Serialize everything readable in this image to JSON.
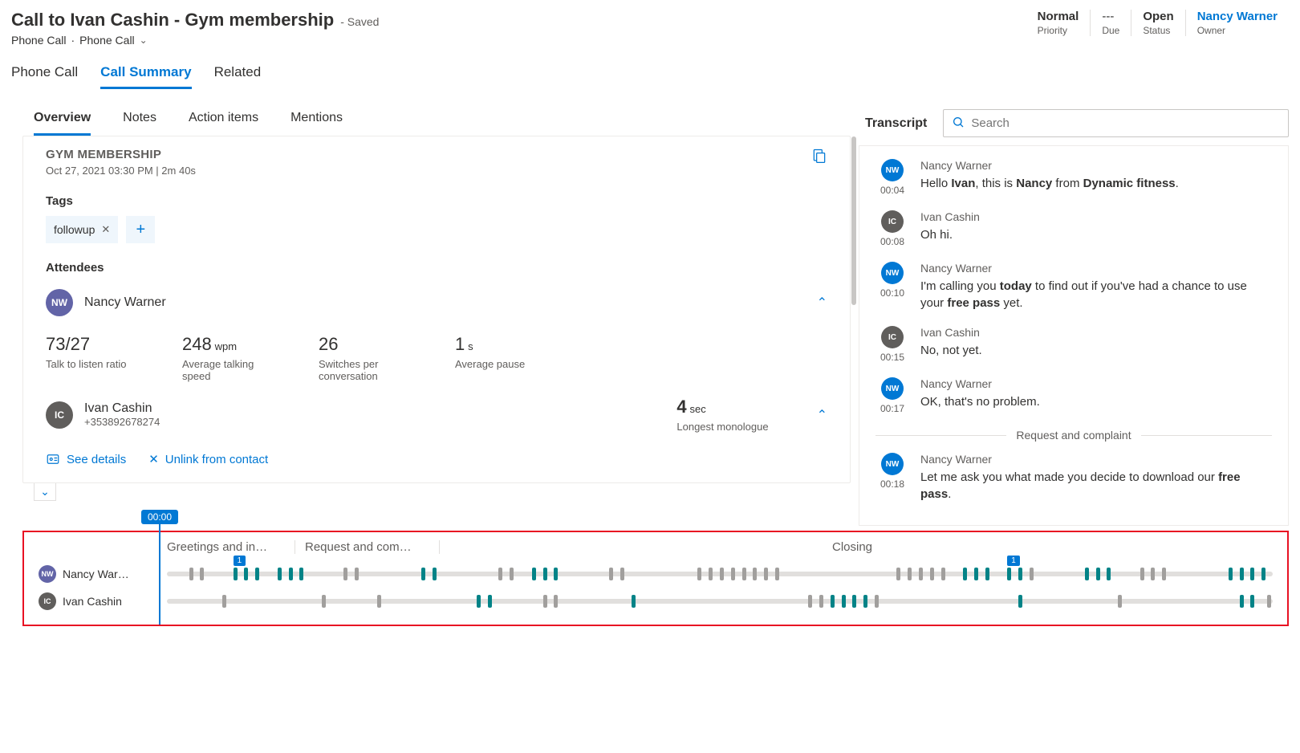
{
  "header": {
    "title": "Call to Ivan Cashin - Gym membership",
    "saved": "- Saved",
    "entity": "Phone Call",
    "subtype": "Phone Call",
    "meta": [
      {
        "value": "Normal",
        "label": "Priority",
        "bold": true
      },
      {
        "value": "---",
        "label": "Due"
      },
      {
        "value": "Open",
        "label": "Status",
        "bold": true
      },
      {
        "value": "Nancy Warner",
        "label": "Owner",
        "link": true
      }
    ]
  },
  "mainTabs": [
    "Phone Call",
    "Call Summary",
    "Related"
  ],
  "mainTabActive": 1,
  "subTabs": [
    "Overview",
    "Notes",
    "Action items",
    "Mentions"
  ],
  "subTabActive": 0,
  "overview": {
    "heading": "GYM MEMBERSHIP",
    "metaLine": "Oct 27, 2021 03:30 PM  |  2m 40s",
    "tagsLabel": "Tags",
    "tags": [
      "followup"
    ],
    "attendeesLabel": "Attendees",
    "attendee1": {
      "initials": "NW",
      "name": "Nancy Warner"
    },
    "stats": [
      {
        "value": "73/27",
        "label": "Talk to listen ratio"
      },
      {
        "value": "248",
        "unit": "wpm",
        "label": "Average talking speed"
      },
      {
        "value": "26",
        "label": "Switches per conversation"
      },
      {
        "value": "1",
        "unit": "s",
        "label": "Average pause"
      }
    ],
    "attendee2": {
      "initials": "IC",
      "name": "Ivan Cashin",
      "phone": "+353892678274"
    },
    "monologue": {
      "value": "4",
      "unit": "sec",
      "label": "Longest monologue"
    },
    "actions": {
      "details": "See details",
      "unlink": "Unlink from contact"
    }
  },
  "transcript": {
    "headLabel": "Transcript",
    "searchPlaceholder": "Search",
    "sectionLabel": "Request and complaint",
    "messages": [
      {
        "av": "nw",
        "initials": "NW",
        "time": "00:04",
        "speaker": "Nancy Warner",
        "html": "Hello <b>Ivan</b>, this is <b>Nancy</b> from <b>Dynamic fitness</b>."
      },
      {
        "av": "ic",
        "initials": "IC",
        "time": "00:08",
        "speaker": "Ivan Cashin",
        "html": "Oh hi."
      },
      {
        "av": "nw",
        "initials": "NW",
        "time": "00:10",
        "speaker": "Nancy Warner",
        "html": "I'm calling you <b>today</b> to find out if you've had a chance to use your <b>free pass</b> yet."
      },
      {
        "av": "ic",
        "initials": "IC",
        "time": "00:15",
        "speaker": "Ivan Cashin",
        "html": "No, not yet."
      },
      {
        "av": "nw",
        "initials": "NW",
        "time": "00:17",
        "speaker": "Nancy Warner",
        "html": "OK, that's no problem."
      },
      {
        "_divider": true
      },
      {
        "av": "nw",
        "initials": "NW",
        "time": "00:18",
        "speaker": "Nancy Warner",
        "html": "Let me ask you what made you decide to download our <b>free pass</b>."
      }
    ]
  },
  "timeline": {
    "playhead": "00:00",
    "segments": {
      "greet": "Greetings and in…",
      "req": "Request and com…",
      "close": "Closing"
    },
    "rows": [
      {
        "av": "nw",
        "initials": "NW",
        "name": "Nancy War…",
        "markers": [
          6,
          76
        ],
        "ticks": [
          {
            "p": 2,
            "c": "gr"
          },
          {
            "p": 3,
            "c": "gr"
          },
          {
            "p": 6,
            "c": "te"
          },
          {
            "p": 7,
            "c": "te"
          },
          {
            "p": 8,
            "c": "te"
          },
          {
            "p": 10,
            "c": "te"
          },
          {
            "p": 11,
            "c": "te"
          },
          {
            "p": 12,
            "c": "te"
          },
          {
            "p": 16,
            "c": "gr"
          },
          {
            "p": 17,
            "c": "gr"
          },
          {
            "p": 23,
            "c": "te"
          },
          {
            "p": 24,
            "c": "te"
          },
          {
            "p": 30,
            "c": "gr"
          },
          {
            "p": 31,
            "c": "gr"
          },
          {
            "p": 33,
            "c": "te"
          },
          {
            "p": 34,
            "c": "te"
          },
          {
            "p": 35,
            "c": "te"
          },
          {
            "p": 40,
            "c": "gr"
          },
          {
            "p": 41,
            "c": "gr"
          },
          {
            "p": 48,
            "c": "gr"
          },
          {
            "p": 49,
            "c": "gr"
          },
          {
            "p": 50,
            "c": "gr"
          },
          {
            "p": 51,
            "c": "gr"
          },
          {
            "p": 52,
            "c": "gr"
          },
          {
            "p": 53,
            "c": "gr"
          },
          {
            "p": 54,
            "c": "gr"
          },
          {
            "p": 55,
            "c": "gr"
          },
          {
            "p": 66,
            "c": "gr"
          },
          {
            "p": 67,
            "c": "gr"
          },
          {
            "p": 68,
            "c": "gr"
          },
          {
            "p": 69,
            "c": "gr"
          },
          {
            "p": 70,
            "c": "gr"
          },
          {
            "p": 72,
            "c": "te"
          },
          {
            "p": 73,
            "c": "te"
          },
          {
            "p": 74,
            "c": "te"
          },
          {
            "p": 76,
            "c": "te"
          },
          {
            "p": 77,
            "c": "te"
          },
          {
            "p": 78,
            "c": "gr"
          },
          {
            "p": 83,
            "c": "te"
          },
          {
            "p": 84,
            "c": "te"
          },
          {
            "p": 85,
            "c": "te"
          },
          {
            "p": 88,
            "c": "gr"
          },
          {
            "p": 89,
            "c": "gr"
          },
          {
            "p": 90,
            "c": "gr"
          },
          {
            "p": 96,
            "c": "te"
          },
          {
            "p": 97,
            "c": "te"
          },
          {
            "p": 98,
            "c": "te"
          },
          {
            "p": 99,
            "c": "te"
          }
        ]
      },
      {
        "av": "ic",
        "initials": "IC",
        "name": "Ivan Cashin",
        "ticks": [
          {
            "p": 5,
            "c": "gr"
          },
          {
            "p": 14,
            "c": "gr"
          },
          {
            "p": 19,
            "c": "gr"
          },
          {
            "p": 28,
            "c": "te"
          },
          {
            "p": 29,
            "c": "te"
          },
          {
            "p": 34,
            "c": "gr"
          },
          {
            "p": 35,
            "c": "gr"
          },
          {
            "p": 42,
            "c": "te"
          },
          {
            "p": 58,
            "c": "gr"
          },
          {
            "p": 59,
            "c": "gr"
          },
          {
            "p": 60,
            "c": "te"
          },
          {
            "p": 61,
            "c": "te"
          },
          {
            "p": 62,
            "c": "te"
          },
          {
            "p": 63,
            "c": "te"
          },
          {
            "p": 64,
            "c": "gr"
          },
          {
            "p": 77,
            "c": "te"
          },
          {
            "p": 86,
            "c": "gr"
          },
          {
            "p": 97,
            "c": "te"
          },
          {
            "p": 98,
            "c": "te"
          },
          {
            "p": 99.5,
            "c": "gr"
          }
        ]
      }
    ]
  }
}
